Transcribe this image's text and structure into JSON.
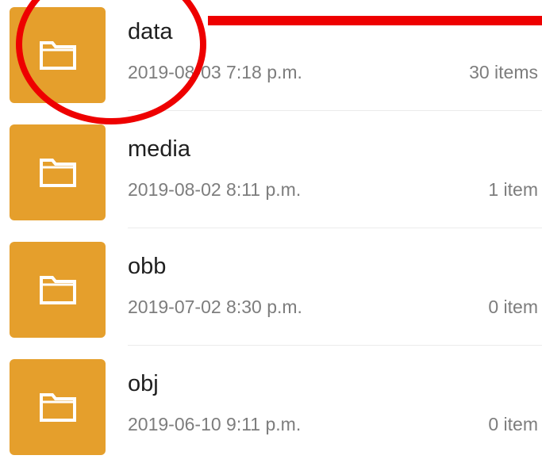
{
  "colors": {
    "folder_tile": "#e59f2c",
    "folder_icon": "#ffffff",
    "annotation": "#ee0000",
    "name_text": "#1f1f1f",
    "meta_text": "#7d7d7d"
  },
  "folders": [
    {
      "name": "data",
      "date": "2019-08-03 7:18 p.m.",
      "count": "30 items",
      "icon": "folder-icon"
    },
    {
      "name": "media",
      "date": "2019-08-02 8:11 p.m.",
      "count": "1 item",
      "icon": "folder-icon"
    },
    {
      "name": "obb",
      "date": "2019-07-02 8:30 p.m.",
      "count": "0 item",
      "icon": "folder-icon"
    },
    {
      "name": "obj",
      "date": "2019-06-10 9:11 p.m.",
      "count": "0 item",
      "icon": "folder-icon"
    }
  ],
  "annotation": {
    "shapes": [
      "circle",
      "line"
    ]
  }
}
